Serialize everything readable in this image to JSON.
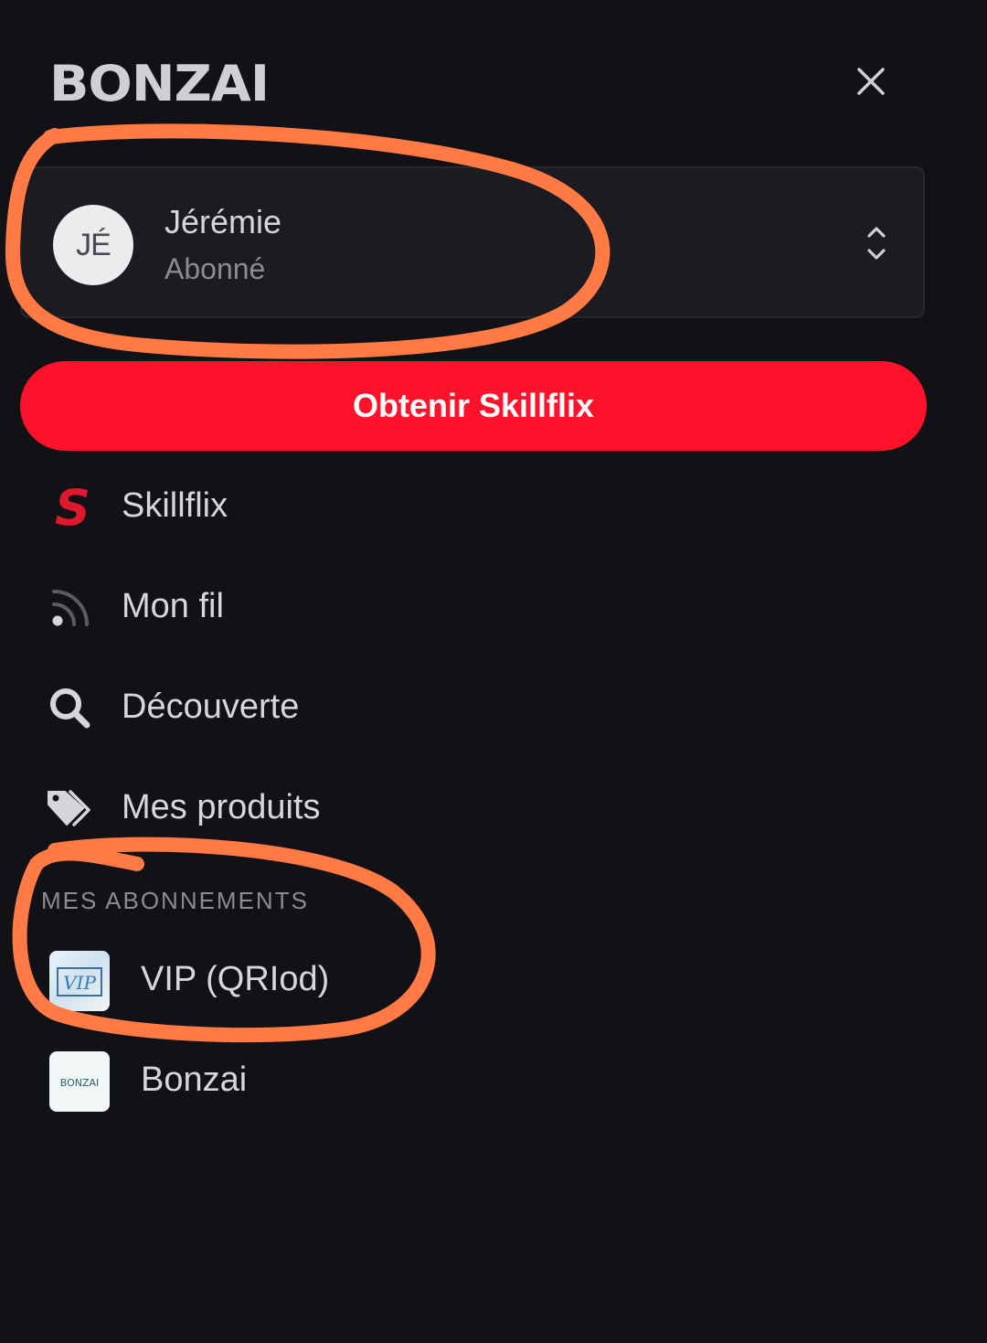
{
  "header": {
    "logo_text": "BONZAI",
    "close_icon": "close-icon"
  },
  "user": {
    "initials": "JÉ",
    "name": "Jérémie",
    "status": "Abonné",
    "switch_icon": "chevron-up-down-icon"
  },
  "cta": {
    "label": "Obtenir Skillflix",
    "color": "#fc132b"
  },
  "nav": {
    "items": [
      {
        "label": "Skillflix",
        "icon": "skillflix-s-icon"
      },
      {
        "label": "Mon fil",
        "icon": "rss-feed-icon"
      },
      {
        "label": "Découverte",
        "icon": "search-icon"
      },
      {
        "label": "Mes produits",
        "icon": "tag-icon"
      }
    ]
  },
  "subscriptions": {
    "title": "MES ABONNEMENTS",
    "items": [
      {
        "label": "VIP (QRIod)",
        "thumb_text": "VIP"
      },
      {
        "label": "Bonzai",
        "thumb_text": "BONZAI"
      }
    ]
  },
  "colors": {
    "background": "#121115",
    "card": "#1c1b20",
    "accent": "#fc132b",
    "annotation": "#ff7a45"
  }
}
